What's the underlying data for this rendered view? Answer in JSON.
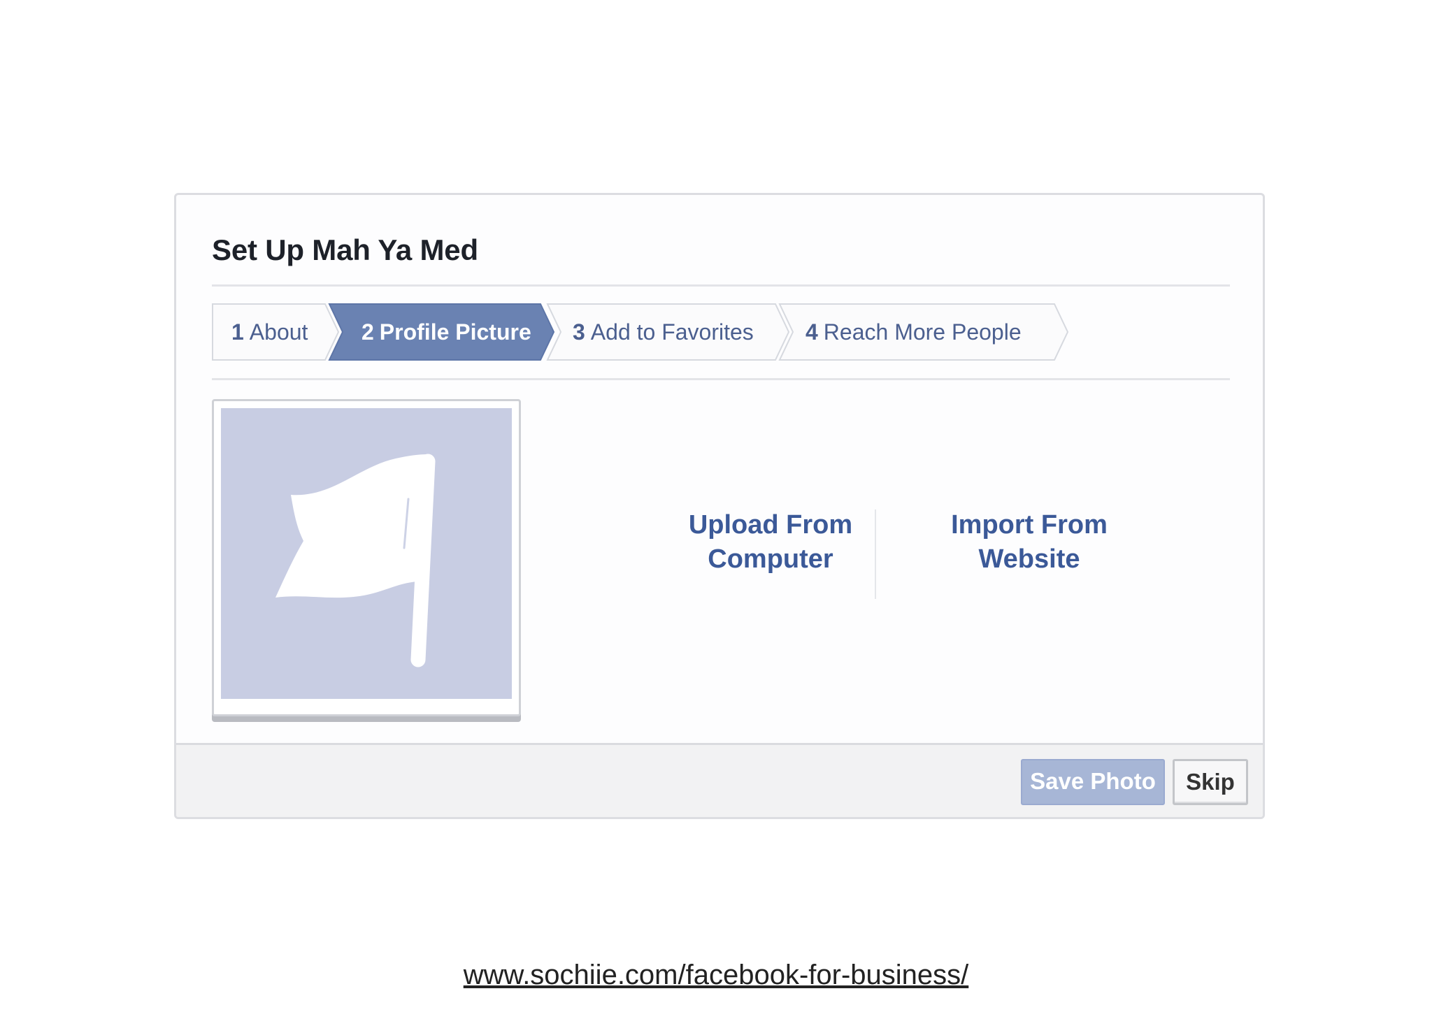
{
  "dialog": {
    "title": "Set Up Mah Ya Med",
    "steps": [
      {
        "number": "1",
        "label": "About",
        "active": false
      },
      {
        "number": "2",
        "label": "Profile Picture",
        "active": true
      },
      {
        "number": "3",
        "label": "Add to Favorites",
        "active": false
      },
      {
        "number": "4",
        "label": "Reach More People",
        "active": false
      }
    ],
    "photo": {
      "icon": "flag-icon"
    },
    "options": {
      "upload": "Upload From\nComputer",
      "import": "Import From\nWebsite"
    },
    "footer": {
      "save_label": "Save Photo",
      "skip_label": "Skip"
    }
  },
  "source_link": "www.sochiie.com/facebook-for-business/",
  "colors": {
    "accent": "#3b5998",
    "active_step": "#6a82b2",
    "placeholder_bg": "#c8cde3",
    "save_disabled": "#a7b6d6"
  }
}
